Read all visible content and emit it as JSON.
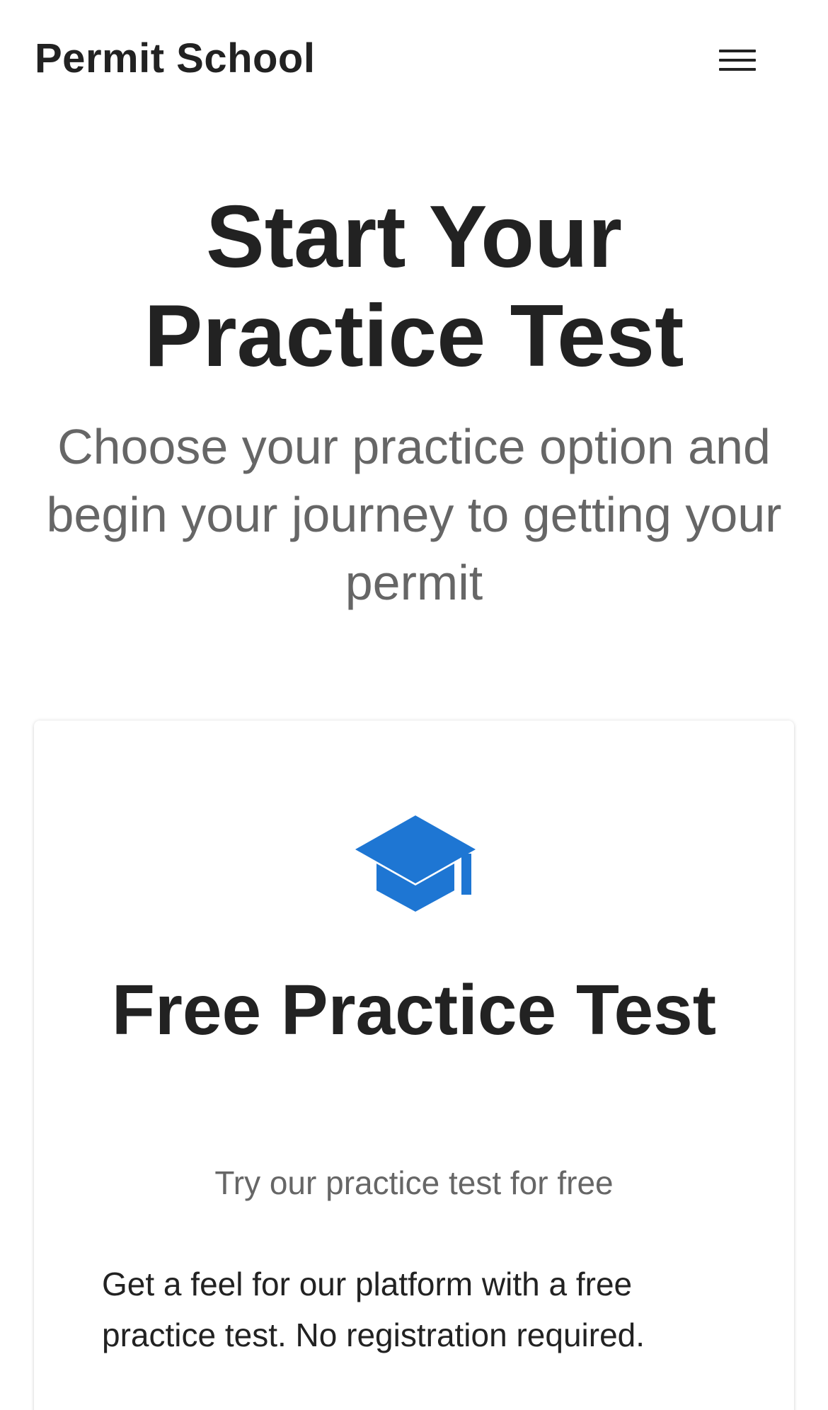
{
  "header": {
    "brand": "Permit School",
    "menu_icon": "hamburger-menu-icon"
  },
  "hero": {
    "title": "Start Your Practice Test",
    "subtitle": "Choose your practice option and begin your journey to getting your permit"
  },
  "card": {
    "icon": "graduation-cap-icon",
    "icon_color": "#1e76d3",
    "title": "Free Practice Test",
    "tagline": "Try our practice test for free",
    "description": "Get a feel for our platform with a free practice test. No registration required."
  }
}
